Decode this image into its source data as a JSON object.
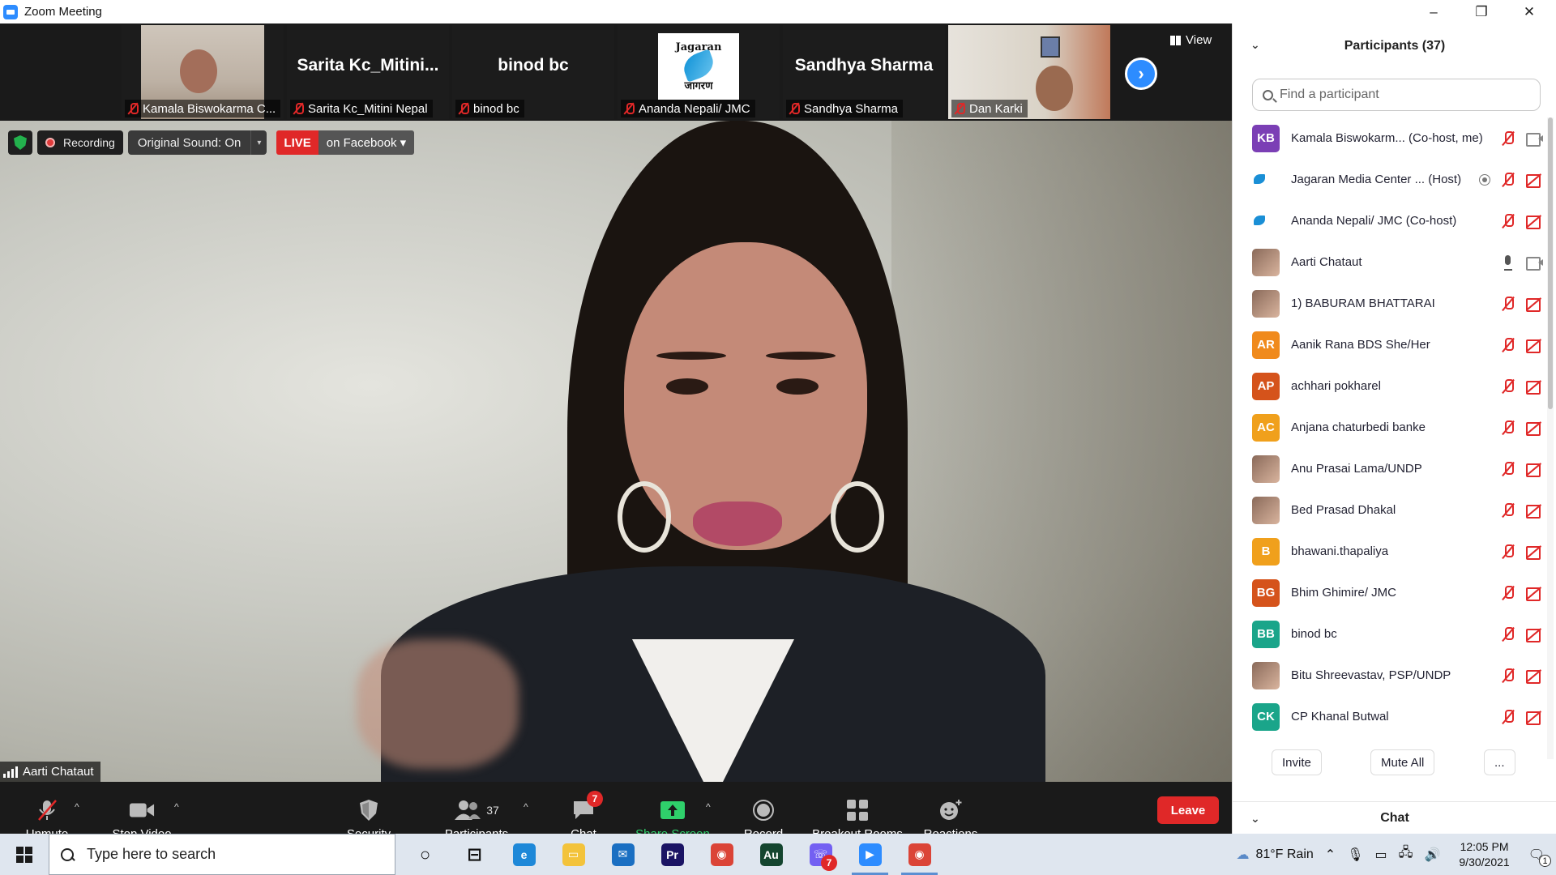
{
  "window": {
    "title": "Zoom Meeting",
    "minimize": "–",
    "maximize": "❐",
    "close": "✕"
  },
  "strip": {
    "tiles": [
      {
        "label": "Kamala Biswokarma C...",
        "big_name": ""
      },
      {
        "label": "Sarita Kc_Mitini Nepal",
        "big_name": "Sarita  Kc_Mitini..."
      },
      {
        "label": "binod bc",
        "big_name": "binod bc"
      },
      {
        "label": "Ananda Nepali/ JMC",
        "big_name": ""
      },
      {
        "label": "Sandhya Sharma",
        "big_name": "Sandhya Sharma"
      },
      {
        "label": "Dan Karki",
        "big_name": ""
      }
    ],
    "logo_word_en": "Jagaran",
    "logo_word_np": "जागरण",
    "view_label": "View",
    "next_glyph": "›"
  },
  "status": {
    "recording": "Recording",
    "original_sound": "Original Sound: On",
    "live": "LIVE",
    "live_target": "on Facebook ▾"
  },
  "speaker": {
    "name": "Aarti Chataut"
  },
  "toolbar": {
    "unmute": "Unmute",
    "stop_video": "Stop Video",
    "security": "Security",
    "participants": "Participants",
    "participants_count": "37",
    "chat": "Chat",
    "chat_badge": "7",
    "share_screen": "Share Screen",
    "record": "Record",
    "breakout": "Breakout Rooms",
    "reactions": "Reactions",
    "leave": "Leave",
    "caret": "^"
  },
  "panel": {
    "title": "Participants (37)",
    "search_placeholder": "Find a participant",
    "participants": [
      {
        "initials": "KB",
        "color": "#7b3fb5",
        "name": "Kamala Biswokarm...  (Co-host, me)",
        "mic": "off",
        "cam": "on"
      },
      {
        "initials": "",
        "color": "logo",
        "name": "Jagaran Media Center ...  (Host)",
        "mic": "off",
        "cam": "off",
        "host": true
      },
      {
        "initials": "",
        "color": "logo",
        "name": "Ananda Nepali/ JMC (Co-host)",
        "mic": "off",
        "cam": "off"
      },
      {
        "initials": "",
        "color": "photo",
        "name": "Aarti Chataut",
        "mic": "on",
        "cam": "on"
      },
      {
        "initials": "",
        "color": "photo",
        "name": "1) BABURAM BHATTARAI",
        "mic": "off",
        "cam": "off"
      },
      {
        "initials": "AR",
        "color": "#f08a1c",
        "name": "Aanik Rana BDS She/Her",
        "mic": "off",
        "cam": "off"
      },
      {
        "initials": "AP",
        "color": "#d5531b",
        "name": "achhari pokharel",
        "mic": "off",
        "cam": "off"
      },
      {
        "initials": "AC",
        "color": "#f0a01c",
        "name": "Anjana chaturbedi banke",
        "mic": "off",
        "cam": "off"
      },
      {
        "initials": "",
        "color": "photo",
        "name": "Anu Prasai Lama/UNDP",
        "mic": "off",
        "cam": "off"
      },
      {
        "initials": "",
        "color": "photo",
        "name": "Bed Prasad Dhakal",
        "mic": "off",
        "cam": "off"
      },
      {
        "initials": "B",
        "color": "#f0a01c",
        "name": "bhawani.thapaliya",
        "mic": "off",
        "cam": "off"
      },
      {
        "initials": "BG",
        "color": "#d5531b",
        "name": "Bhim Ghimire/ JMC",
        "mic": "off",
        "cam": "off"
      },
      {
        "initials": "BB",
        "color": "#1aa58a",
        "name": "binod bc",
        "mic": "off",
        "cam": "off"
      },
      {
        "initials": "",
        "color": "photo",
        "name": "Bitu Shreevastav, PSP/UNDP",
        "mic": "off",
        "cam": "off"
      },
      {
        "initials": "CK",
        "color": "#1aa58a",
        "name": "CP Khanal Butwal",
        "mic": "off",
        "cam": "off"
      }
    ],
    "invite": "Invite",
    "mute_all": "Mute All",
    "more": "...",
    "chat_title": "Chat"
  },
  "taskbar": {
    "search_placeholder": "Type here to search",
    "apps": [
      {
        "name": "task-view",
        "glyph": "○",
        "color": "transparent"
      },
      {
        "name": "timeline",
        "glyph": "⊟",
        "color": "transparent"
      },
      {
        "name": "edge",
        "glyph": "e",
        "color": "#1e88d8"
      },
      {
        "name": "file-explorer",
        "glyph": "▭",
        "color": "#f3c33b"
      },
      {
        "name": "mail",
        "glyph": "✉",
        "color": "#1a6fc2"
      },
      {
        "name": "premiere",
        "glyph": "Pr",
        "color": "#1b1464"
      },
      {
        "name": "chrome",
        "glyph": "◉",
        "color": "#db4437"
      },
      {
        "name": "audition",
        "glyph": "Au",
        "color": "#14452f"
      },
      {
        "name": "viber",
        "glyph": "☏",
        "color": "#7360f2",
        "badge": "7"
      },
      {
        "name": "zoom",
        "glyph": "▶",
        "color": "#2d8cff"
      },
      {
        "name": "chrome-2",
        "glyph": "◉",
        "color": "#db4437"
      }
    ],
    "weather": "81°F  Rain",
    "time": "12:05 PM",
    "date": "9/30/2021",
    "notification_count": "1"
  }
}
